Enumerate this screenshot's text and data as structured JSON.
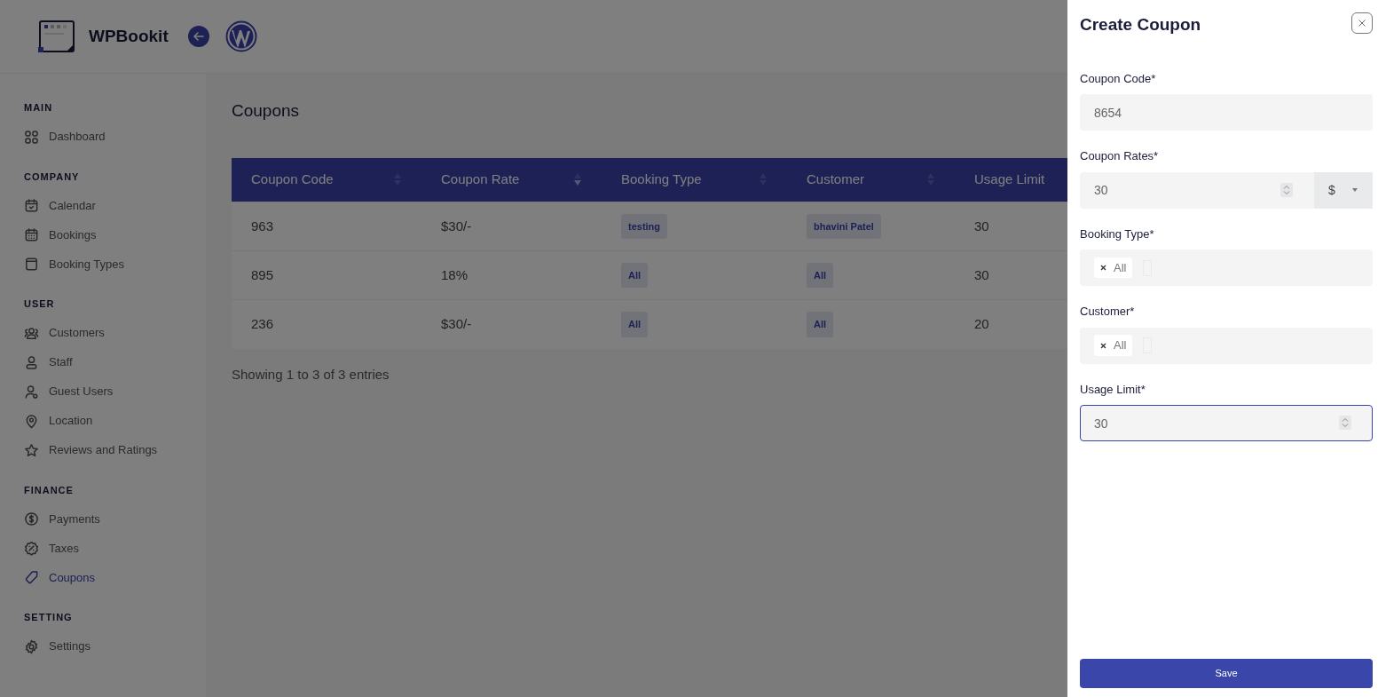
{
  "brand": {
    "name": "WPBookit"
  },
  "sidebar": {
    "sections": [
      {
        "title": "MAIN",
        "items": [
          {
            "label": "Dashboard",
            "kind": "grid",
            "selected": false
          }
        ]
      },
      {
        "title": "COMPANY",
        "items": [
          {
            "label": "Calendar",
            "kind": "calendar-check",
            "selected": false
          },
          {
            "label": "Bookings",
            "kind": "calendar",
            "selected": false
          },
          {
            "label": "Booking Types",
            "kind": "page",
            "selected": false
          }
        ]
      },
      {
        "title": "USER",
        "items": [
          {
            "label": "Customers",
            "kind": "people",
            "selected": false
          },
          {
            "label": "Staff",
            "kind": "person",
            "selected": false
          },
          {
            "label": "Guest Users",
            "kind": "guest",
            "selected": false
          },
          {
            "label": "Location",
            "kind": "pin",
            "selected": false
          },
          {
            "label": "Reviews and Ratings",
            "kind": "star",
            "selected": false
          }
        ]
      },
      {
        "title": "FINANCE",
        "items": [
          {
            "label": "Payments",
            "kind": "dollar",
            "selected": false
          },
          {
            "label": "Taxes",
            "kind": "percent",
            "selected": false
          },
          {
            "label": "Coupons",
            "kind": "tag",
            "selected": true
          }
        ]
      },
      {
        "title": "SETTING",
        "items": [
          {
            "label": "Settings",
            "kind": "gear",
            "selected": false
          }
        ]
      }
    ]
  },
  "page": {
    "title": "Coupons"
  },
  "table": {
    "columns": [
      {
        "label": "Coupon Code",
        "sorted": false
      },
      {
        "label": "Coupon Rate",
        "sorted": true
      },
      {
        "label": "Booking Type",
        "sorted": false
      },
      {
        "label": "Customer",
        "sorted": false
      },
      {
        "label": "Usage Limit"
      }
    ],
    "rows": [
      {
        "code": "963",
        "rate": "$30/-",
        "booking_type": "testing",
        "customer": "bhavini Patel",
        "usage_limit": "30"
      },
      {
        "code": "895",
        "rate": "18%",
        "booking_type": "All",
        "customer": "All",
        "usage_limit": "30"
      },
      {
        "code": "236",
        "rate": "$30/-",
        "booking_type": "All",
        "customer": "All",
        "usage_limit": "20"
      }
    ]
  },
  "table_info": "Showing 1 to 3 of 3 entries",
  "drawer": {
    "title": "Create Coupon",
    "fields": [
      {
        "kind": "text",
        "label": "Coupon Code*",
        "value": "8654",
        "focused": false
      },
      {
        "kind": "number_currency",
        "label": "Coupon Rates*",
        "value": "30",
        "currency": "$",
        "focused": false
      },
      {
        "kind": "tags",
        "label": "Booking Type*",
        "tags": [
          "All"
        ],
        "focused": false
      },
      {
        "kind": "tags",
        "label": "Customer*",
        "tags": [
          "All"
        ],
        "focused": false
      },
      {
        "kind": "number",
        "label": "Usage Limit*",
        "value": "30",
        "focused": true
      }
    ],
    "save_button": "Save"
  }
}
